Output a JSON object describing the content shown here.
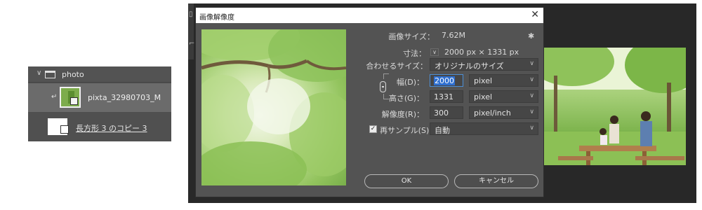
{
  "layers": {
    "group": {
      "name": "photo",
      "chevron": "chevron-down-icon",
      "icon": "folder-icon"
    },
    "selected_layer": {
      "name": "pixta_32980703_M",
      "icon": "smart-object-icon"
    },
    "second_layer": {
      "name": "長方形 3 のコピー 3",
      "icon": "vector-mask-icon"
    }
  },
  "dialog": {
    "title": "画像解像度",
    "close_glyph": "✕",
    "image_size_label": "画像サイズ：",
    "image_size_value": "7.62M",
    "dimensions_label": "寸法：",
    "dimensions_value": "2000 px × 1331 px",
    "fit_label": "合わせるサイズ：",
    "fit_value": "オリジナルのサイズ",
    "width_label": "幅(D)：",
    "width_value": "2000",
    "width_unit": "pixel",
    "height_label": "高さ(G)：",
    "height_value": "1331",
    "height_unit": "pixel",
    "resolution_label": "解像度(R)：",
    "resolution_value": "300",
    "resolution_unit": "pixel/inch",
    "resample_label": "再サンプル(S)：",
    "resample_checked": true,
    "resample_value": "自動",
    "ok_label": "OK",
    "cancel_label": "キャンセル"
  },
  "colors": {
    "dialog_bg": "#535353",
    "workspace_bg": "#282828",
    "field_bg": "#464646",
    "focus_border": "#4d8fd6"
  }
}
